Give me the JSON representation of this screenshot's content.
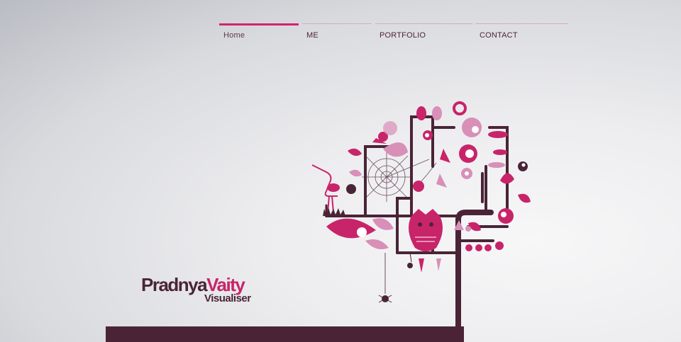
{
  "nav": {
    "items": [
      {
        "label": "Home",
        "active": true
      },
      {
        "label": "ME",
        "active": false
      },
      {
        "label": "PORTFOLIO",
        "active": false
      },
      {
        "label": "CONTACT",
        "active": false
      }
    ]
  },
  "logo": {
    "first": "Pradnya",
    "last": "Vaity",
    "subtitle": "Visualiser"
  },
  "colors": {
    "accent": "#d2246f",
    "brown": "#4a2436",
    "pink_light": "#d88fb8",
    "background": "#ededef"
  },
  "illustration": {
    "name": "tree-illustration-icon"
  }
}
